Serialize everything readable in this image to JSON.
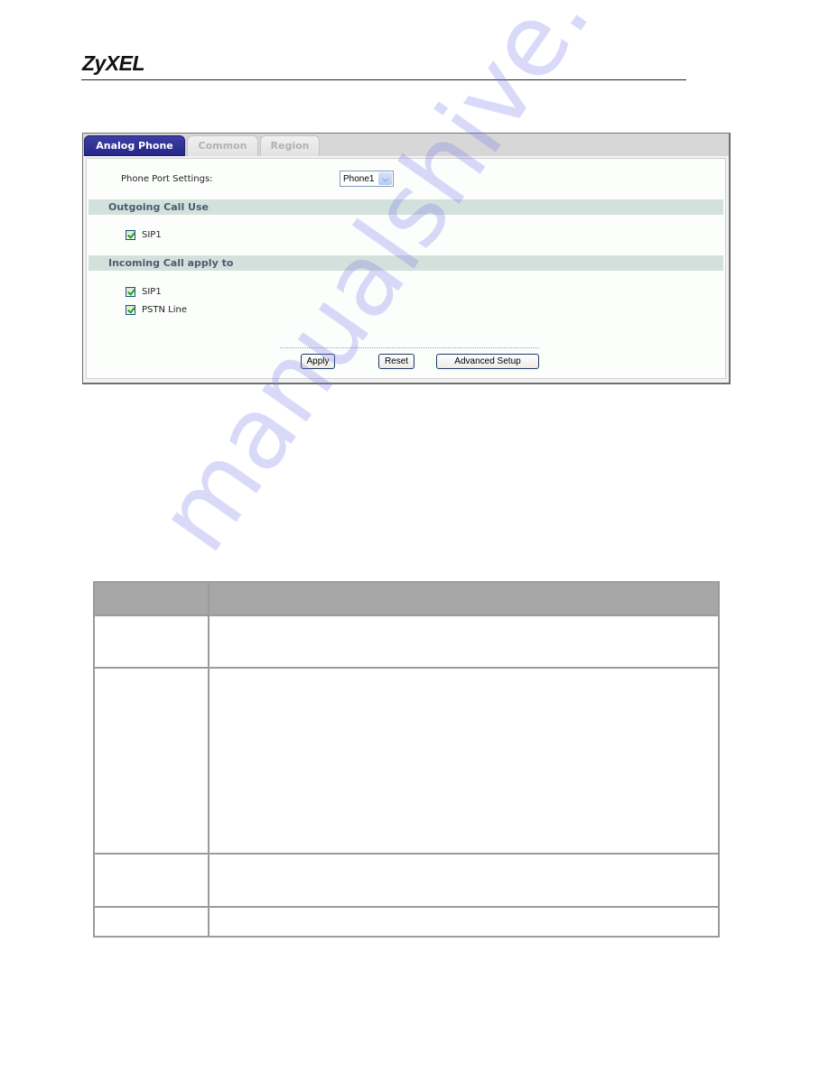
{
  "header": {
    "brand": "ZyXEL"
  },
  "screenshot": {
    "tabs": [
      {
        "label": "Analog Phone",
        "active": true
      },
      {
        "label": "Common",
        "active": false
      },
      {
        "label": "Region",
        "active": false
      }
    ],
    "phone_port": {
      "label": "Phone Port Settings:",
      "selected": "Phone1"
    },
    "sections": {
      "outgoing": {
        "title": "Outgoing Call Use",
        "items": [
          {
            "label": "SIP1",
            "checked": true
          }
        ]
      },
      "incoming": {
        "title": "Incoming Call apply to",
        "items": [
          {
            "label": "SIP1",
            "checked": true
          },
          {
            "label": "PSTN Line",
            "checked": true
          }
        ]
      }
    },
    "buttons": {
      "apply": "Apply",
      "reset": "Reset",
      "advanced": "Advanced Setup"
    },
    "colors": {
      "active_tab": "#2e3096",
      "section_header_bg": "#d3e1dc",
      "section_header_text": "#4c5a72"
    }
  },
  "watermark": "manualshive.com",
  "description_table": {
    "headers": [
      "",
      ""
    ],
    "rows": [
      [
        "",
        ""
      ],
      [
        "",
        ""
      ],
      [
        "",
        ""
      ],
      [
        "",
        ""
      ]
    ]
  }
}
